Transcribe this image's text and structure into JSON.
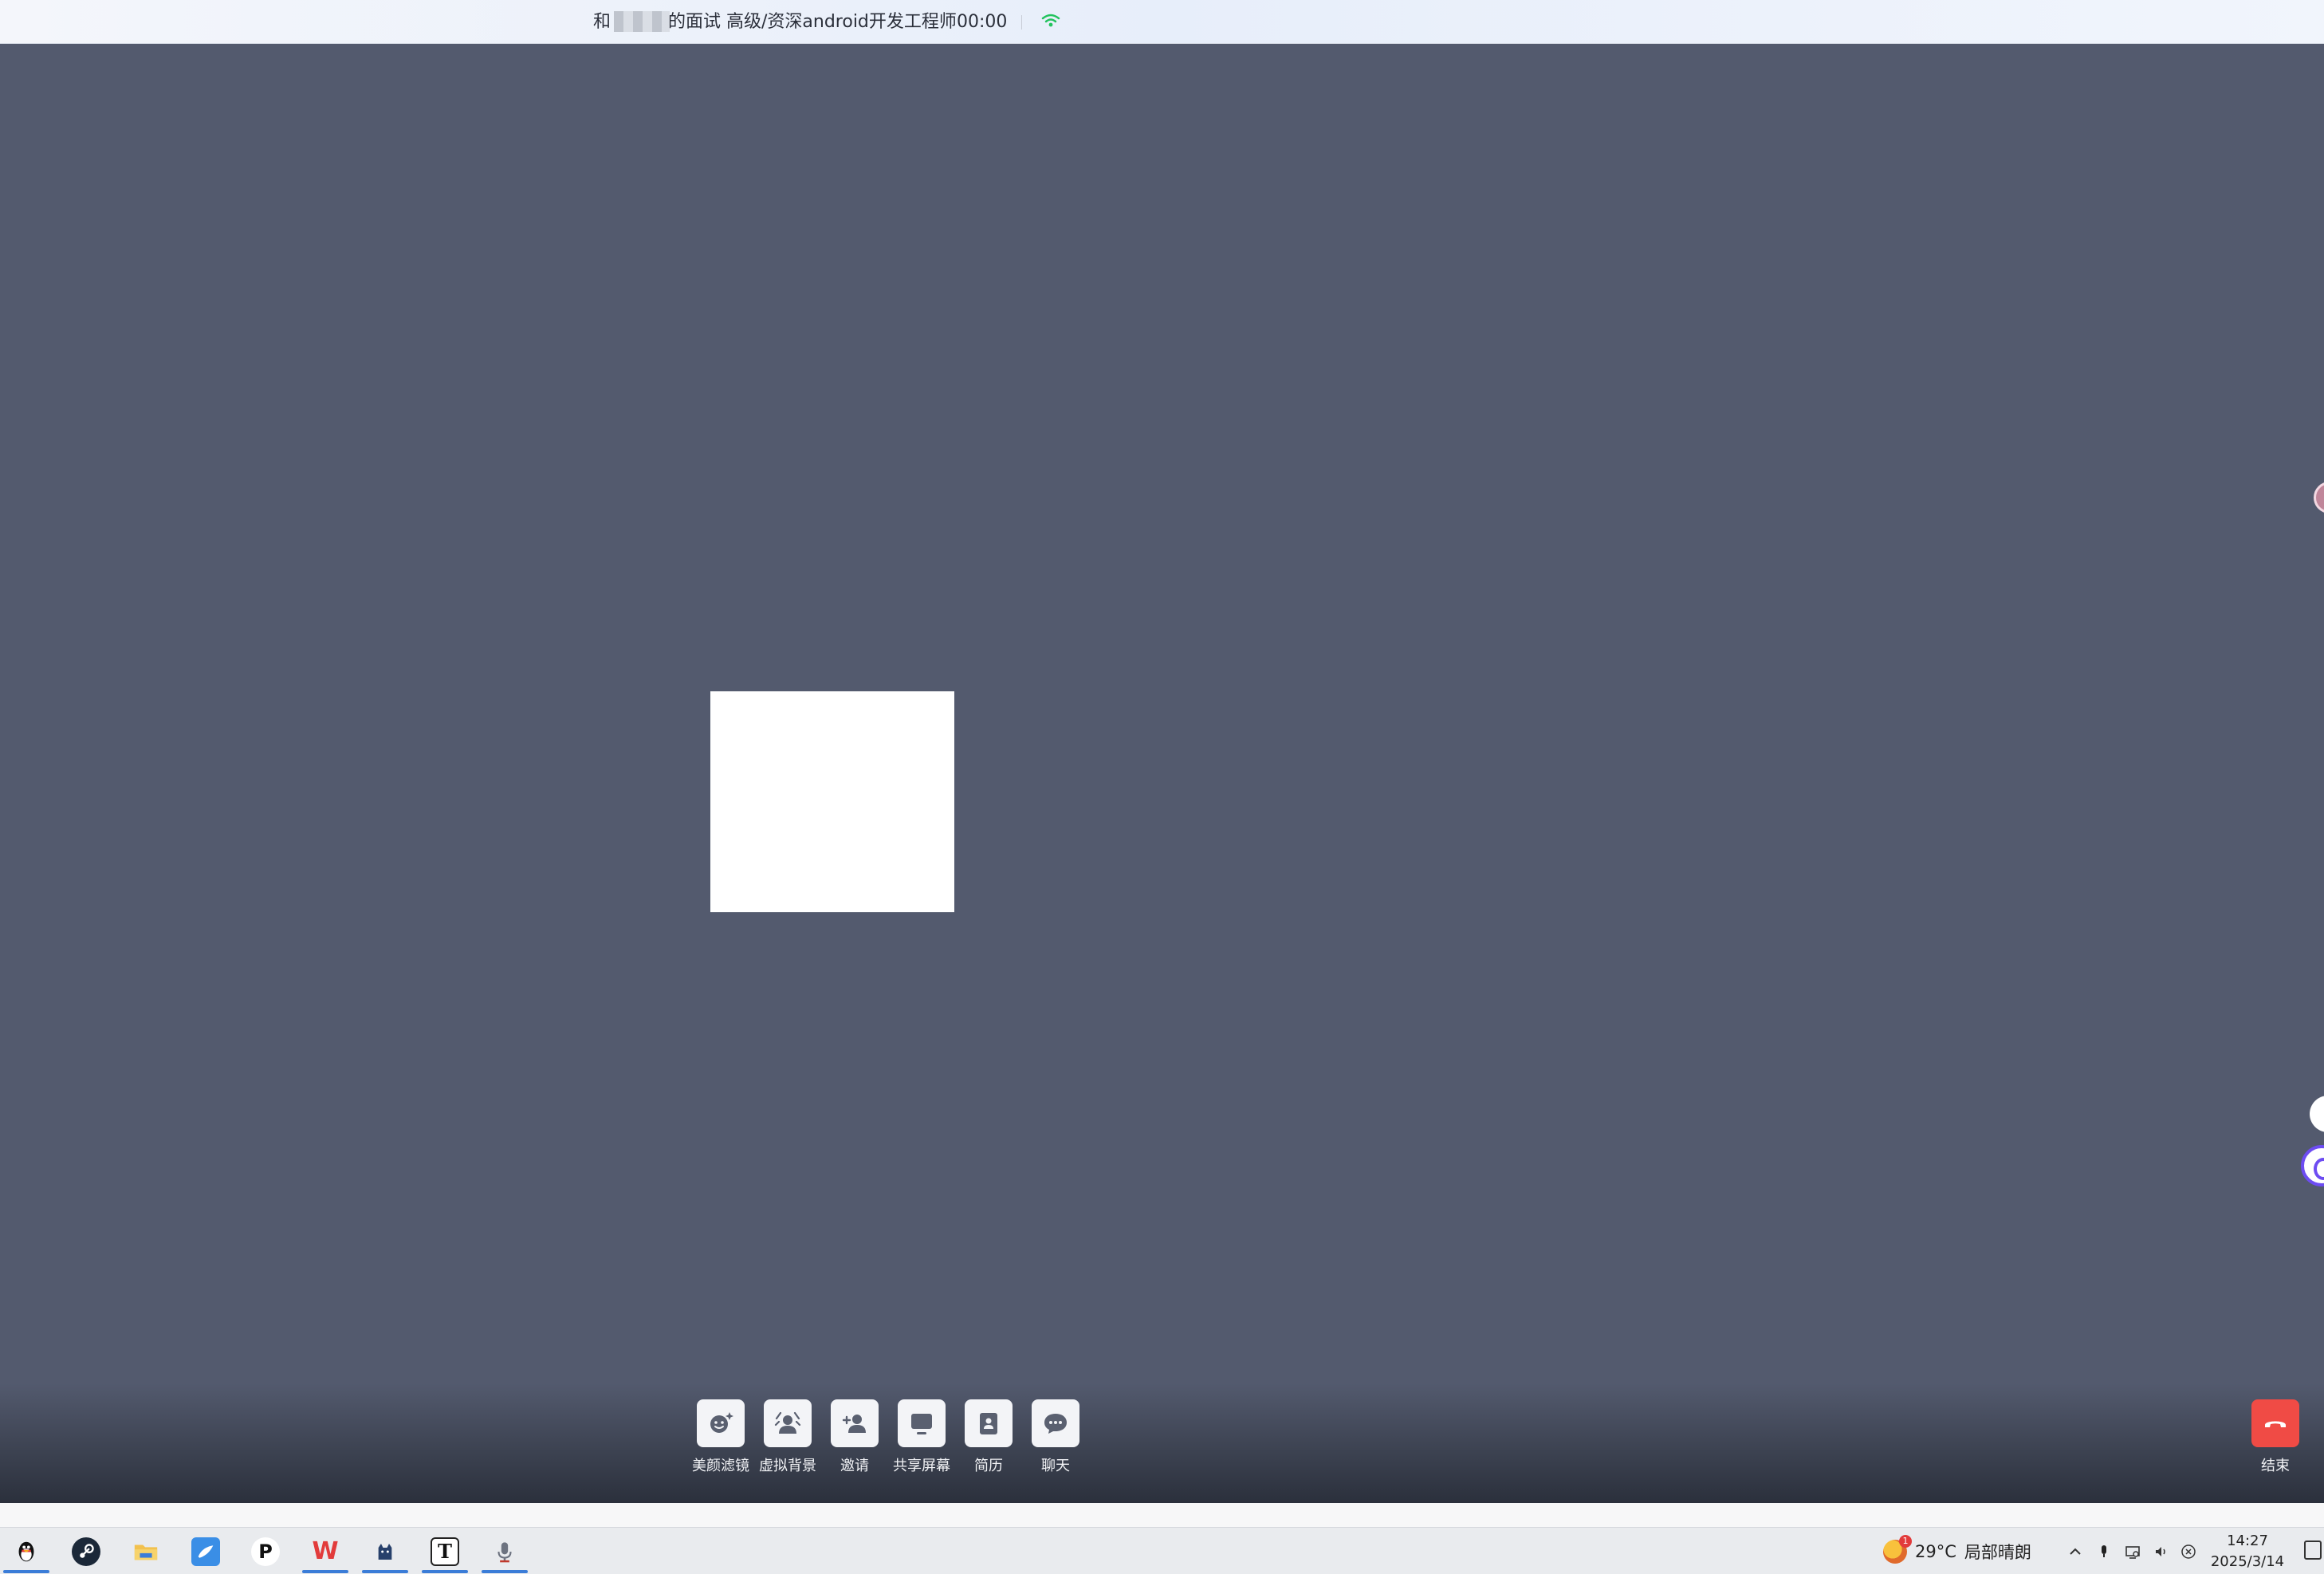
{
  "title_bar": {
    "prefix": "和",
    "title": "的面试 高级/资深android开发工程师",
    "timer": "00:00",
    "signal_icon": "wifi-icon",
    "accent_color": "#22c35d"
  },
  "controls": [
    {
      "id": "beauty",
      "label": "美颜滤镜",
      "icon": "face-sparkle-icon"
    },
    {
      "id": "background",
      "label": "虚拟背景",
      "icon": "person-background-icon"
    },
    {
      "id": "invite",
      "label": "邀请",
      "icon": "add-person-icon"
    },
    {
      "id": "share",
      "label": "共享屏幕",
      "icon": "monitor-icon"
    },
    {
      "id": "resume",
      "label": "简历",
      "icon": "resume-icon"
    },
    {
      "id": "chat",
      "label": "聊天",
      "icon": "chat-bubble-icon"
    }
  ],
  "end_call": {
    "label": "结束",
    "icon": "hang-up-icon",
    "color": "#f04b45"
  },
  "taskbar": {
    "apps": [
      {
        "name": "qq",
        "icon": "qq-penguin-icon"
      },
      {
        "name": "steam",
        "icon": "steam-icon"
      },
      {
        "name": "file-explorer",
        "icon": "folder-icon"
      },
      {
        "name": "feishu",
        "icon": "bird-icon"
      },
      {
        "name": "p-app",
        "icon": "p-letter-icon",
        "glyph": "P"
      },
      {
        "name": "wps",
        "icon": "wps-icon",
        "glyph": "W"
      },
      {
        "name": "cat-app",
        "icon": "cat-icon"
      },
      {
        "name": "typora",
        "icon": "t-letter-icon",
        "glyph": "T"
      },
      {
        "name": "recorder",
        "icon": "microphone-app-icon"
      }
    ],
    "weather": {
      "temp": "29°C",
      "condition": "局部晴朗",
      "badge": "1"
    },
    "tray_icons": [
      "chevron-up-icon",
      "microphone-icon",
      "network-icon",
      "volume-icon",
      "close-circle-icon"
    ],
    "clock": {
      "time": "14:27",
      "date": "2025/3/14"
    }
  }
}
